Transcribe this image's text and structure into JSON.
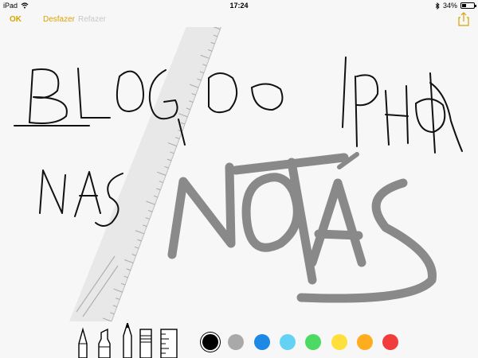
{
  "status": {
    "device": "iPad",
    "time": "17:24",
    "battery": "34%",
    "battery_level": 0.34
  },
  "toolbar": {
    "ok_label": "OK",
    "undo_label": "Desfazer",
    "redo_label": "Refazer"
  },
  "tools": [
    "pen",
    "marker",
    "pencil",
    "eraser",
    "ruler"
  ],
  "colors": [
    {
      "name": "black",
      "hex": "#000000",
      "selected": true
    },
    {
      "name": "gray",
      "hex": "#a9a9a9"
    },
    {
      "name": "blue",
      "hex": "#1e88e5"
    },
    {
      "name": "light-blue",
      "hex": "#64d2f5"
    },
    {
      "name": "green",
      "hex": "#4cd964"
    },
    {
      "name": "yellow",
      "hex": "#ffe03a"
    },
    {
      "name": "orange",
      "hex": "#ffad1f"
    },
    {
      "name": "red",
      "hex": "#f23b3b"
    }
  ]
}
